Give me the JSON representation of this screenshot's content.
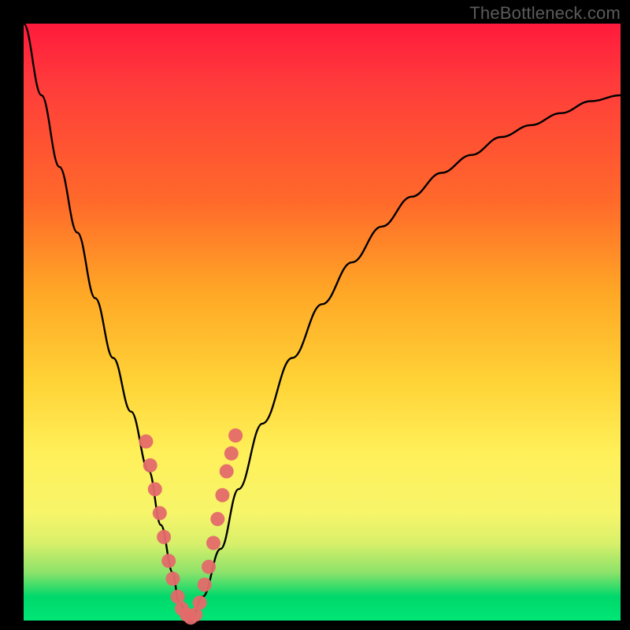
{
  "watermark": "TheBottleneck.com",
  "gradient": {
    "top": "#ff1a3c",
    "mid_upper": "#ff6a2a",
    "mid": "#ffd336",
    "mid_lower": "#fff05a",
    "band": "#d9f06a",
    "bottom": "#00e676"
  },
  "curve_color": "#000000",
  "marker_color": "#e46a6a",
  "chart_data": {
    "type": "line",
    "title": "",
    "xlabel": "",
    "ylabel": "",
    "xlim": [
      0,
      100
    ],
    "ylim": [
      0,
      100
    ],
    "grid": false,
    "legend": false,
    "series": [
      {
        "name": "bottleneck-curve",
        "x": [
          0,
          3,
          6,
          9,
          12,
          15,
          18,
          21,
          23,
          25,
          26,
          28,
          30,
          33,
          36,
          40,
          45,
          50,
          55,
          60,
          65,
          70,
          75,
          80,
          85,
          90,
          95,
          100
        ],
        "y": [
          100,
          88,
          76,
          65,
          54,
          44,
          35,
          25,
          16,
          8,
          3,
          0,
          4,
          12,
          22,
          33,
          44,
          53,
          60,
          66,
          71,
          75,
          78,
          81,
          83,
          85,
          87,
          88
        ]
      }
    ],
    "markers": [
      {
        "x": 20.5,
        "y": 30
      },
      {
        "x": 21.2,
        "y": 26
      },
      {
        "x": 22.0,
        "y": 22
      },
      {
        "x": 22.8,
        "y": 18
      },
      {
        "x": 23.5,
        "y": 14
      },
      {
        "x": 24.3,
        "y": 10
      },
      {
        "x": 25.0,
        "y": 7
      },
      {
        "x": 25.8,
        "y": 4
      },
      {
        "x": 26.5,
        "y": 2
      },
      {
        "x": 27.3,
        "y": 1
      },
      {
        "x": 28.0,
        "y": 0.5
      },
      {
        "x": 28.8,
        "y": 1
      },
      {
        "x": 29.5,
        "y": 3
      },
      {
        "x": 30.3,
        "y": 6
      },
      {
        "x": 31.0,
        "y": 9
      },
      {
        "x": 31.8,
        "y": 13
      },
      {
        "x": 32.5,
        "y": 17
      },
      {
        "x": 33.3,
        "y": 21
      },
      {
        "x": 34.0,
        "y": 25
      },
      {
        "x": 34.8,
        "y": 28
      },
      {
        "x": 35.5,
        "y": 31
      }
    ]
  }
}
